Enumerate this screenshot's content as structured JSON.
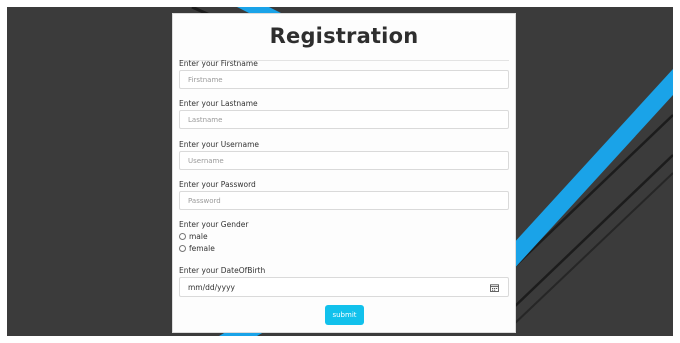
{
  "form": {
    "title": "Registration",
    "fields": [
      {
        "label": "Enter your Firstname",
        "placeholder": "Firstname",
        "value": ""
      },
      {
        "label": "Enter your Lastname",
        "placeholder": "Lastname",
        "value": ""
      },
      {
        "label": "Enter your Username",
        "placeholder": "Username",
        "value": ""
      },
      {
        "label": "Enter your Password",
        "placeholder": "Password",
        "value": ""
      }
    ],
    "gender": {
      "label": "Enter your Gender",
      "options": [
        "male",
        "female"
      ]
    },
    "dob": {
      "label": "Enter your DateOfBirth",
      "value": "mm/dd/yyyy",
      "icon": "calendar-icon"
    },
    "submit_label": "submit"
  },
  "colors": {
    "background": "#3b3b3b",
    "stripe_accent": "#1aa3e8",
    "stripe_line": "#1c1c1c",
    "submit_button": "#12c1ec"
  }
}
